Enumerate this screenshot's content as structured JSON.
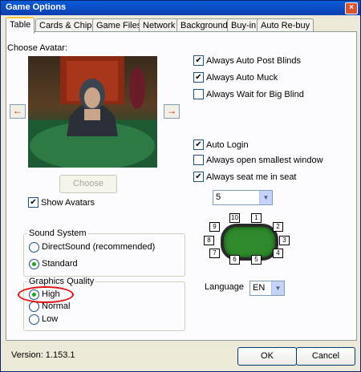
{
  "window": {
    "title": "Game Options",
    "close": "×"
  },
  "tabs": [
    "Table",
    "Cards & Chips",
    "Game Files",
    "Network",
    "Background",
    "Buy-in",
    "Auto Re-buy"
  ],
  "avatar": {
    "label": "Choose Avatar:",
    "choose_button": "Choose",
    "show_avatars": "Show Avatars",
    "show_avatars_checked": true,
    "left_arrow": "←",
    "right_arrow": "→"
  },
  "options_top": [
    {
      "label": "Always Auto Post Blinds",
      "checked": true
    },
    {
      "label": "Always Auto Muck",
      "checked": true
    },
    {
      "label": "Always Wait for Big Blind",
      "checked": false
    }
  ],
  "options_mid": [
    {
      "label": "Auto Login",
      "checked": true
    },
    {
      "label": "Always open smallest window",
      "checked": false
    },
    {
      "label": "Always seat me in seat",
      "checked": true
    }
  ],
  "seat_select": {
    "value": "5"
  },
  "seats": [
    "1",
    "2",
    "3",
    "4",
    "5",
    "6",
    "7",
    "8",
    "9",
    "10"
  ],
  "language": {
    "label": "Language",
    "value": "EN"
  },
  "sound": {
    "title": "Sound System",
    "options": [
      "DirectSound (recommended)",
      "Standard"
    ],
    "selected": "Standard"
  },
  "graphics": {
    "title": "Graphics Quality",
    "options": [
      "High",
      "Normal",
      "Low"
    ],
    "selected": "High"
  },
  "footer": {
    "version": "Version: 1.153.1",
    "ok": "OK",
    "cancel": "Cancel"
  },
  "check_glyph": "✔"
}
